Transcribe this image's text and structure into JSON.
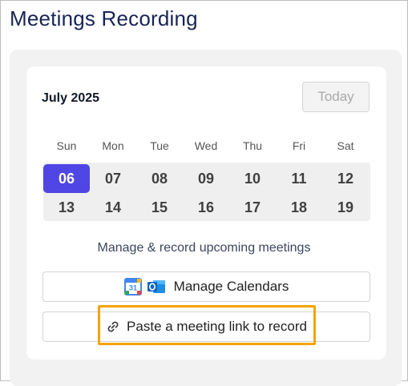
{
  "header": {
    "title": "Meetings Recording"
  },
  "calendar": {
    "month_label": "July 2025",
    "today_label": "Today",
    "weekdays": [
      "Sun",
      "Mon",
      "Tue",
      "Wed",
      "Thu",
      "Fri",
      "Sat"
    ],
    "week1": [
      "06",
      "07",
      "08",
      "09",
      "10",
      "11",
      "12"
    ],
    "week2": [
      "13",
      "14",
      "15",
      "16",
      "17",
      "18",
      "19"
    ],
    "selected_day": "06"
  },
  "actions": {
    "description": "Manage & record upcoming meetings",
    "manage_calendars_label": "Manage Calendars",
    "paste_link_label": "Paste a meeting link to record",
    "google_calendar_badge": "31"
  },
  "colors": {
    "accent": "#4f46e5",
    "highlight": "#f5a300",
    "title": "#172554"
  },
  "icons": [
    "google-calendar-icon",
    "outlook-icon",
    "link-icon"
  ]
}
